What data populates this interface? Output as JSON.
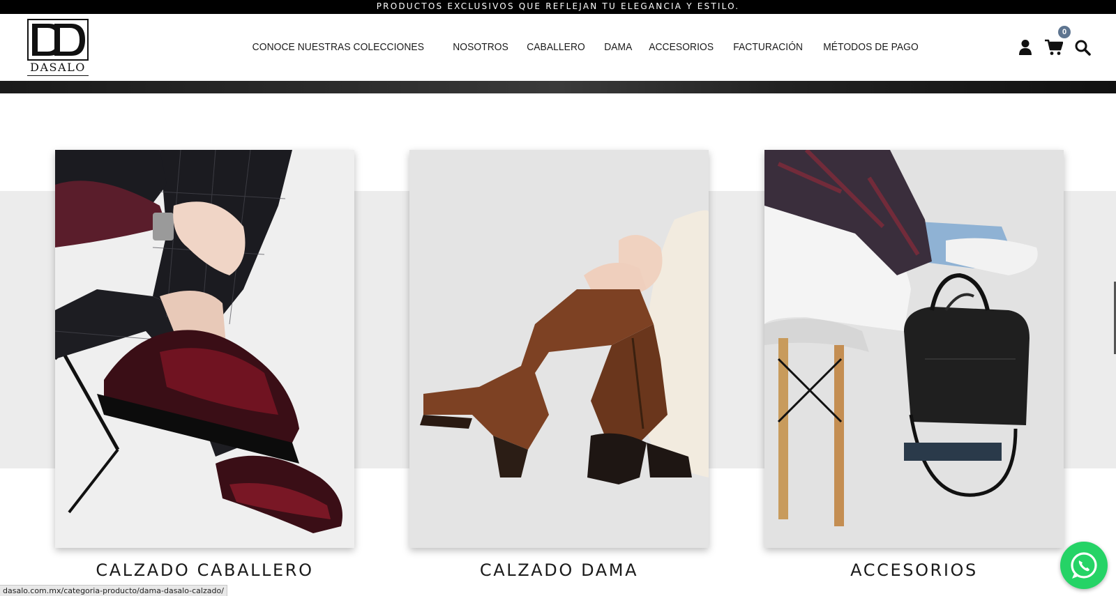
{
  "announcement": "PRODUCTOS EXCLUSIVOS QUE REFLEJAN TU ELEGANCIA Y ESTILO.",
  "brand": {
    "logo_text": "DASALO"
  },
  "nav": [
    {
      "label": "CONOCE NUESTRAS COLECCIONES"
    },
    {
      "label": "NOSOTROS"
    },
    {
      "label": "CABALLERO"
    },
    {
      "label": "DAMA"
    },
    {
      "label": "ACCESORIOS"
    },
    {
      "label": "FACTURACIÓN"
    },
    {
      "label": "MÉTODOS DE PAGO"
    }
  ],
  "header_icons": {
    "user": "user-icon",
    "cart": "cart-icon",
    "search": "search-icon",
    "cart_count": "0"
  },
  "categories": [
    {
      "title": "CALZADO CABALLERO",
      "image": "men-loafers-photo"
    },
    {
      "title": "CALZADO DAMA",
      "image": "women-boots-photo"
    },
    {
      "title": "ACCESORIOS",
      "image": "black-duffel-bag-photo"
    }
  ],
  "status_bar": {
    "url": "dasalo.com.mx/categoria-producto/dama-dasalo-calzado/"
  },
  "colors": {
    "announcement_bg": "#000000",
    "badge": "#5e7590",
    "whatsapp": "#25d366",
    "band": "#ececec"
  }
}
